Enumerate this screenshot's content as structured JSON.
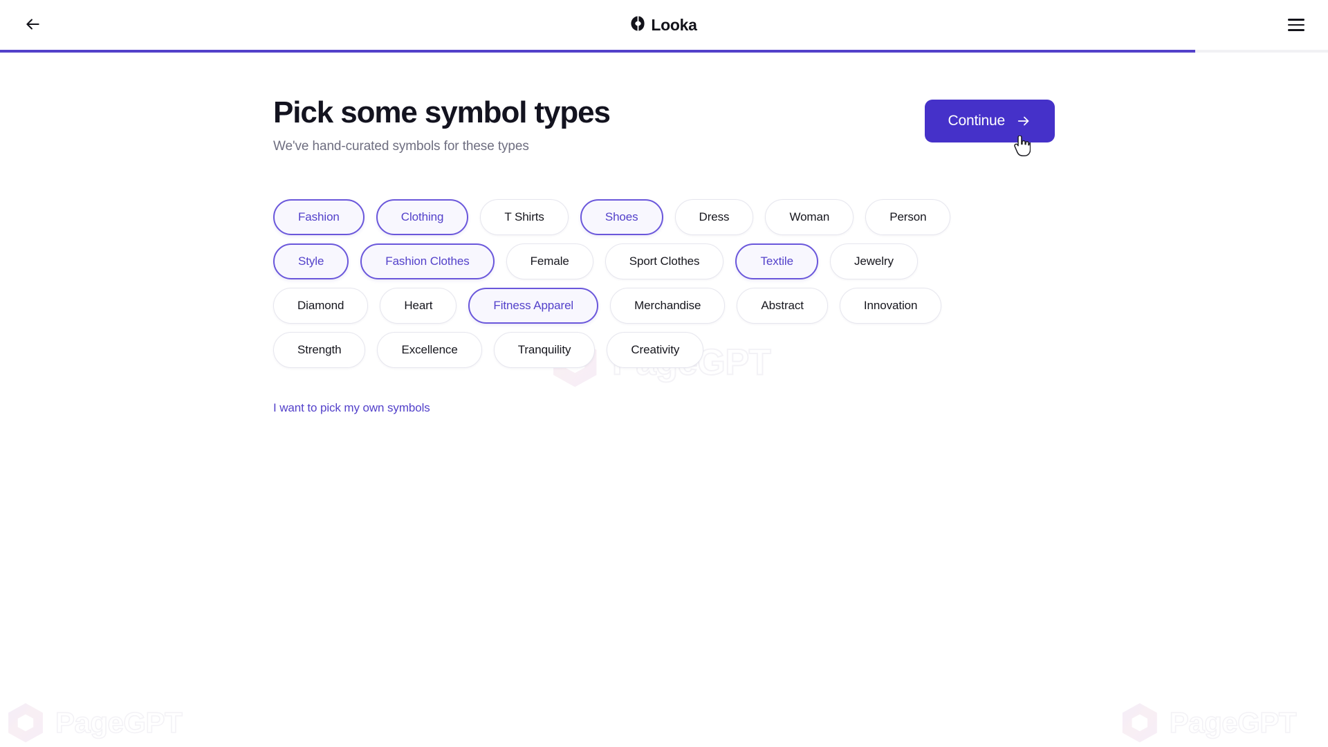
{
  "header": {
    "back_label": "Back",
    "back_icon": "arrow-left-icon",
    "brand_name": "Looka",
    "brand_icon": "looka-logo-mark",
    "menu_icon": "hamburger-menu-icon"
  },
  "progress": {
    "percent": "90",
    "fill_color": "#5341ca",
    "track_color": "#f1f1f4"
  },
  "main": {
    "title": "Pick some symbol types",
    "subtitle": "We've hand-curated symbols for these types",
    "continue_label": "Continue",
    "continue_icon": "arrow-right-icon",
    "own_symbols_link": "I want to pick my own symbols"
  },
  "colors": {
    "accent": "#4531c9",
    "accent_text": "#5341ca",
    "selected_border": "#6a57db",
    "selected_bg": "#f8f7fe",
    "pill_border": "#e6e6ee",
    "title": "#13131f",
    "subtitle": "#6e6e80"
  },
  "symbol_rows": [
    [
      {
        "label": "Fashion",
        "selected": true
      },
      {
        "label": "Clothing",
        "selected": true
      },
      {
        "label": "T Shirts",
        "selected": false
      },
      {
        "label": "Shoes",
        "selected": true
      },
      {
        "label": "Dress",
        "selected": false
      },
      {
        "label": "Woman",
        "selected": false
      },
      {
        "label": "Person",
        "selected": false
      }
    ],
    [
      {
        "label": "Style",
        "selected": true
      },
      {
        "label": "Fashion Clothes",
        "selected": true
      },
      {
        "label": "Female",
        "selected": false
      },
      {
        "label": "Sport Clothes",
        "selected": false
      },
      {
        "label": "Textile",
        "selected": true
      },
      {
        "label": "Jewelry",
        "selected": false
      }
    ],
    [
      {
        "label": "Diamond",
        "selected": false
      },
      {
        "label": "Heart",
        "selected": false
      },
      {
        "label": "Fitness Apparel",
        "selected": true
      },
      {
        "label": "Merchandise",
        "selected": false
      },
      {
        "label": "Abstract",
        "selected": false
      },
      {
        "label": "Innovation",
        "selected": false
      }
    ],
    [
      {
        "label": "Strength",
        "selected": false
      },
      {
        "label": "Excellence",
        "selected": false
      },
      {
        "label": "Tranquility",
        "selected": false
      },
      {
        "label": "Creativity",
        "selected": false
      }
    ]
  ],
  "watermark": {
    "text": "PageGPT",
    "icon": "hexagon-logo-icon"
  },
  "cursor": {
    "icon": "pointing-hand-cursor"
  }
}
